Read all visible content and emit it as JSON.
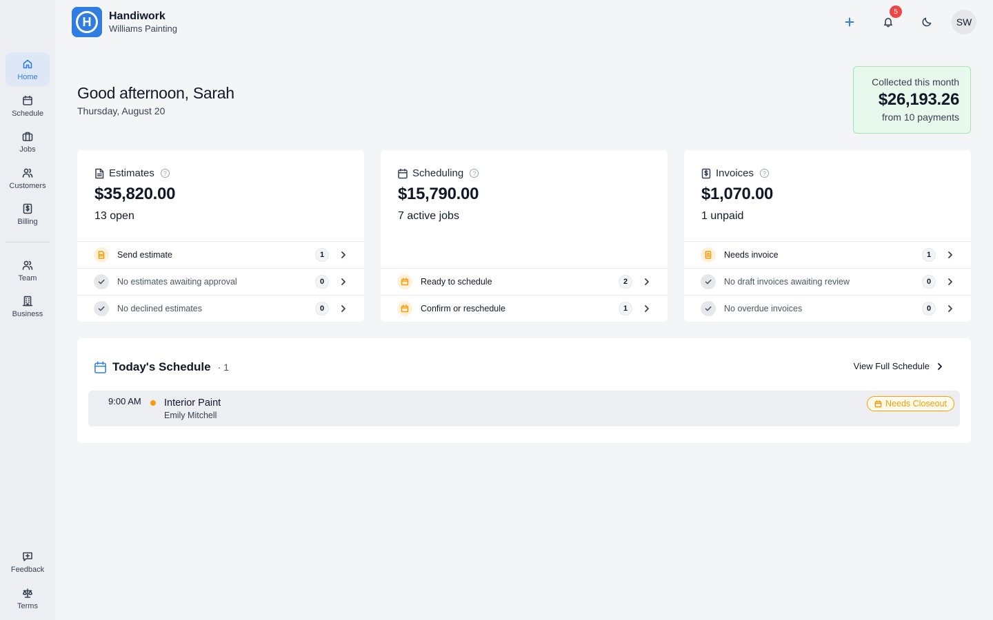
{
  "app": {
    "name": "Handiwork",
    "company": "Williams Painting",
    "logo_letter": "H"
  },
  "header": {
    "notification_count": "5",
    "avatar_initials": "SW"
  },
  "sidebar": {
    "items": [
      {
        "label": "Home",
        "icon": "home-icon"
      },
      {
        "label": "Schedule",
        "icon": "calendar-icon"
      },
      {
        "label": "Jobs",
        "icon": "briefcase-icon"
      },
      {
        "label": "Customers",
        "icon": "users-icon"
      },
      {
        "label": "Billing",
        "icon": "receipt-icon"
      },
      {
        "label": "Team",
        "icon": "team-icon"
      },
      {
        "label": "Business",
        "icon": "building-icon"
      },
      {
        "label": "Feedback",
        "icon": "feedback-icon"
      },
      {
        "label": "Terms",
        "icon": "scale-icon"
      }
    ]
  },
  "greeting": {
    "title": "Good afternoon, Sarah",
    "date": "Thursday, August 20"
  },
  "collected": {
    "label": "Collected this month",
    "amount": "$26,193.26",
    "sub": "from 10 payments"
  },
  "cards": {
    "estimates": {
      "title": "Estimates",
      "amount": "$35,820.00",
      "sub": "13 open",
      "rows": [
        {
          "label": "Send estimate",
          "count": "1"
        },
        {
          "label": "No estimates awaiting approval",
          "count": "0"
        },
        {
          "label": "No declined estimates",
          "count": "0"
        }
      ]
    },
    "scheduling": {
      "title": "Scheduling",
      "amount": "$15,790.00",
      "sub": "7 active jobs",
      "rows": [
        {
          "label": "Ready to schedule",
          "count": "2"
        },
        {
          "label": "Confirm or reschedule",
          "count": "1"
        }
      ]
    },
    "invoices": {
      "title": "Invoices",
      "amount": "$1,070.00",
      "sub": "1 unpaid",
      "rows": [
        {
          "label": "Needs invoice",
          "count": "1"
        },
        {
          "label": "No draft invoices awaiting review",
          "count": "0"
        },
        {
          "label": "No overdue invoices",
          "count": "0"
        }
      ]
    }
  },
  "schedule": {
    "title": "Today's Schedule",
    "count": "· 1",
    "view_full": "View Full Schedule",
    "jobs": [
      {
        "time": "9:00 AM",
        "title": "Interior Paint",
        "client": "Emily Mitchell",
        "status": "Needs Closeout"
      }
    ]
  },
  "colors": {
    "accent": "#2f7de1",
    "warning": "#f59e0b",
    "success_bg": "#e7f8ec",
    "badge_red": "#ef4444"
  }
}
